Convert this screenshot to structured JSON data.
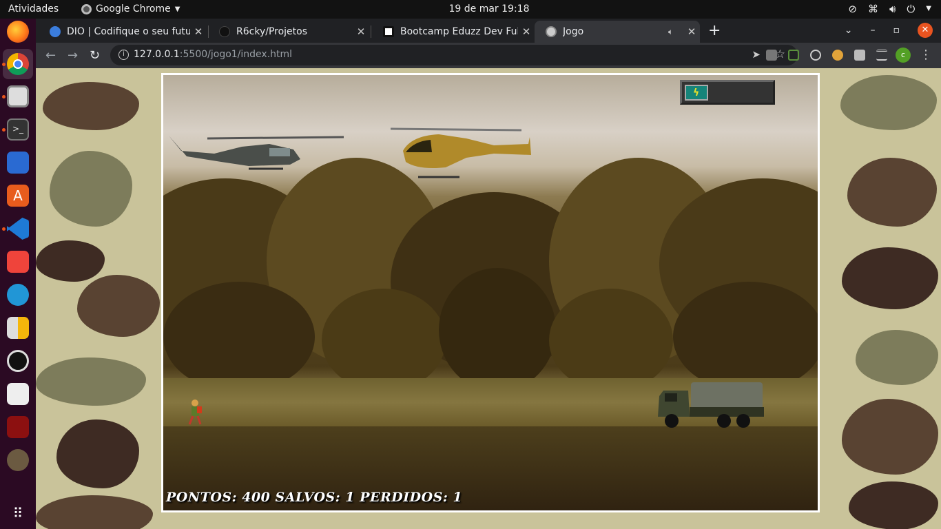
{
  "topbar": {
    "activities": "Atividades",
    "app_name": "Google Chrome",
    "clock": "19 de mar  19:18"
  },
  "tabs": [
    {
      "title": "DIO | Codifique o seu futuro",
      "favicon": "dio-icon",
      "active": false
    },
    {
      "title": "R6cky/Projetos",
      "favicon": "github-icon",
      "active": false
    },
    {
      "title": "Bootcamp Eduzz Dev Fullstack",
      "favicon": "dio-logo-icon",
      "active": false
    },
    {
      "title": "Jogo",
      "favicon": "globe-icon",
      "active": true
    }
  ],
  "address_bar": {
    "host": "127.0.0.1",
    "path": ":5500/jogo1/index.html"
  },
  "profile_initial": "c",
  "game": {
    "score_label": "PONTOS: 400 SALVOS: 1 PERDIDOS: 1",
    "energy_level": 1,
    "energy_max": 3
  },
  "colors": {
    "os_bar": "#121212",
    "dock": "#2b0a23",
    "chrome_dark": "#202124",
    "chrome_toolbar": "#35363a",
    "accent_orange": "#e95420",
    "profile_green": "#53a025"
  }
}
